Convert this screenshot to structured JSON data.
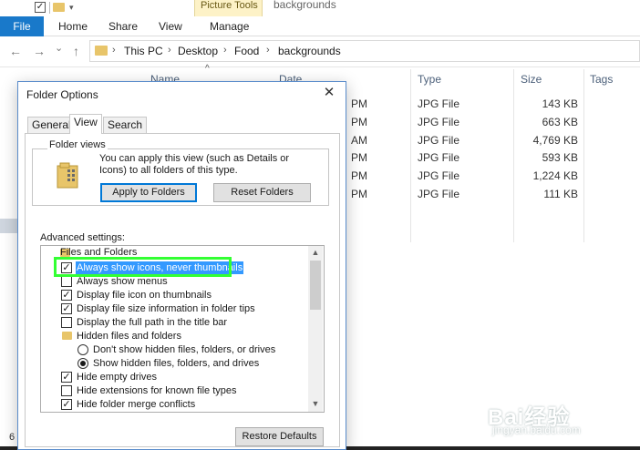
{
  "explorer": {
    "window_title": "backgrounds",
    "quick_access": {
      "check_glyph": "✓",
      "arrow_glyph": "▾"
    },
    "ribbon": {
      "context_label": "Picture Tools",
      "tabs": [
        "File",
        "Home",
        "Share",
        "View",
        "Manage"
      ]
    },
    "nav": {
      "back": "←",
      "forward": "→",
      "recent": "⌄",
      "up": "↑"
    },
    "breadcrumb": [
      "This PC",
      "Desktop",
      "Food",
      "backgrounds"
    ],
    "breadcrumb_sep": "›",
    "sort_caret": "^",
    "columns": [
      "Name",
      "Date",
      "Type",
      "Size",
      "Tags"
    ],
    "files": [
      {
        "time": "PM",
        "type": "JPG File",
        "size": "143 KB"
      },
      {
        "time": "PM",
        "type": "JPG File",
        "size": "663 KB"
      },
      {
        "time": "AM",
        "type": "JPG File",
        "size": "4,769 KB"
      },
      {
        "time": "PM",
        "type": "JPG File",
        "size": "593 KB"
      },
      {
        "time": "PM",
        "type": "JPG File",
        "size": "1,224 KB"
      },
      {
        "time": "PM",
        "type": "JPG File",
        "size": "111 KB"
      }
    ],
    "status_count": "6",
    "watermark": {
      "brand": "Bai经验",
      "url": "jingyan.baidu.com"
    }
  },
  "dialog": {
    "title": "Folder Options",
    "close_glyph": "✕",
    "tabs": [
      "General",
      "View",
      "Search"
    ],
    "folder_views": {
      "legend": "Folder views",
      "description": "You can apply this view (such as Details or Icons) to all folders of this type.",
      "apply_button": "Apply to Folders",
      "reset_button": "Reset Folders"
    },
    "advanced_label": "Advanced settings:",
    "check_glyph": "✓",
    "scroll_up": "▲",
    "scroll_down": "▼",
    "advanced_items": [
      {
        "kind": "folder",
        "label": "Files and Folders",
        "checked": false
      },
      {
        "kind": "checkbox",
        "label": "Always show icons, never thumbnails",
        "checked": true,
        "selected": true
      },
      {
        "kind": "checkbox",
        "label": "Always show menus",
        "checked": false
      },
      {
        "kind": "checkbox",
        "label": "Display file icon on thumbnails",
        "checked": true
      },
      {
        "kind": "checkbox",
        "label": "Display file size information in folder tips",
        "checked": true
      },
      {
        "kind": "checkbox",
        "label": "Display the full path in the title bar",
        "checked": false
      },
      {
        "kind": "folder",
        "label": "Hidden files and folders",
        "checked": false
      },
      {
        "kind": "radio",
        "label": "Don't show hidden files, folders, or drives",
        "checked": false
      },
      {
        "kind": "radio",
        "label": "Show hidden files, folders, and drives",
        "checked": true
      },
      {
        "kind": "checkbox",
        "label": "Hide empty drives",
        "checked": true
      },
      {
        "kind": "checkbox",
        "label": "Hide extensions for known file types",
        "checked": false
      },
      {
        "kind": "checkbox",
        "label": "Hide folder merge conflicts",
        "checked": true
      }
    ],
    "restore_button": "Restore Defaults"
  },
  "colors": {
    "file_tab": "#1979ca",
    "context_tab": "#fdf2c7",
    "selection": "#3399ff",
    "highlight_frame": "#33ff33"
  }
}
